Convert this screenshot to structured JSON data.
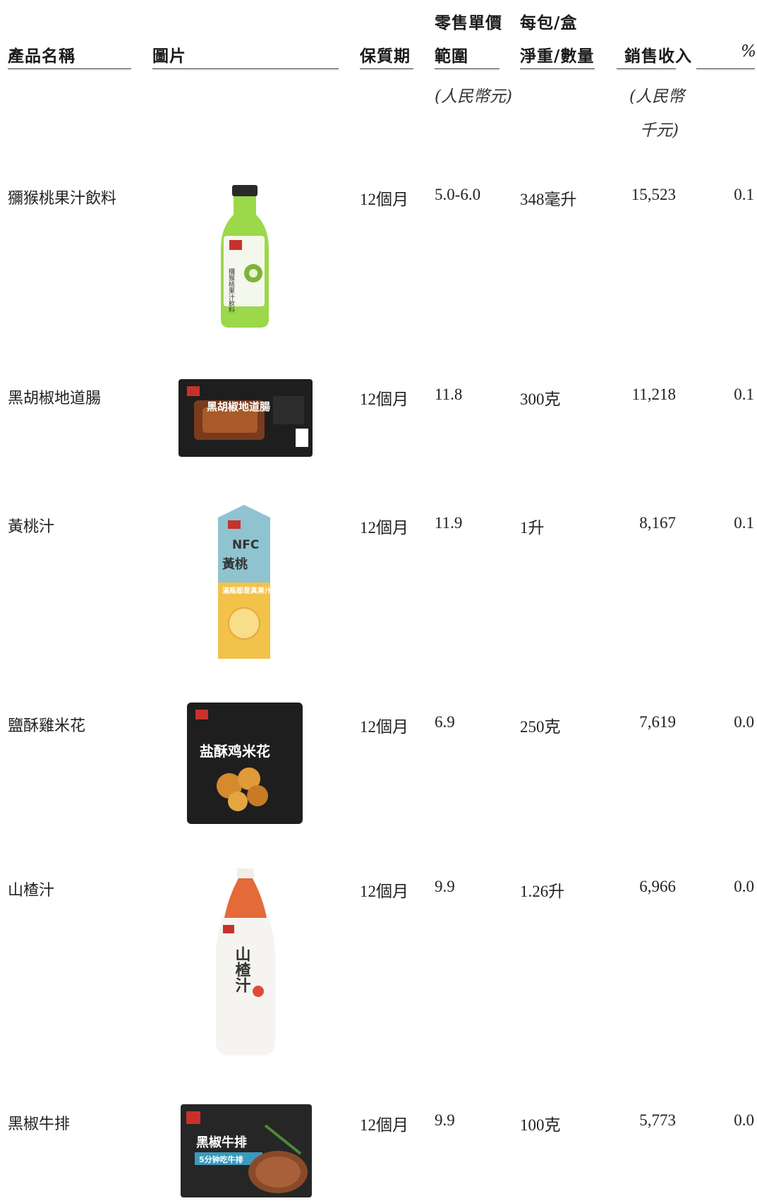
{
  "headers": {
    "product_name": "產品名稱",
    "image": "圖片",
    "shelf_life": "保質期",
    "price_line1": "零售單價",
    "price_line2": "範圍",
    "price_unit": "(人民幣元)",
    "weight_line1": "每包/盒",
    "weight_line2": "淨重/數量",
    "revenue": "銷售收入",
    "revenue_unit_line1": "(人民幣",
    "revenue_unit_line2": "千元)",
    "percent": "%"
  },
  "rows": [
    {
      "name": "獼猴桃果汁飲料",
      "image_icon": "kiwi-juice-bottle",
      "shelf_life": "12個月",
      "price": "5.0-6.0",
      "weight": "348毫升",
      "revenue": "15,523",
      "percent": "0.1"
    },
    {
      "name": "黑胡椒地道腸",
      "image_icon": "black-pepper-sausage-pack",
      "shelf_life": "12個月",
      "price": "11.8",
      "weight": "300克",
      "revenue": "11,218",
      "percent": "0.1"
    },
    {
      "name": "黃桃汁",
      "image_icon": "yellow-peach-juice-carton",
      "shelf_life": "12個月",
      "price": "11.9",
      "weight": "1升",
      "revenue": "8,167",
      "percent": "0.1"
    },
    {
      "name": "鹽酥雞米花",
      "image_icon": "popcorn-chicken-bag",
      "shelf_life": "12個月",
      "price": "6.9",
      "weight": "250克",
      "revenue": "7,619",
      "percent": "0.0"
    },
    {
      "name": "山楂汁",
      "image_icon": "hawthorn-juice-bottle",
      "shelf_life": "12個月",
      "price": "9.9",
      "weight": "1.26升",
      "revenue": "6,966",
      "percent": "0.0"
    },
    {
      "name": "黑椒牛排",
      "image_icon": "black-pepper-steak-pack",
      "shelf_life": "12個月",
      "price": "9.9",
      "weight": "100克",
      "revenue": "5,773",
      "percent": "0.0"
    }
  ],
  "package_text": {
    "kiwi_label": "獼猴桃果汁飲料",
    "sausage_label": "黑胡椒地道腸",
    "peach_nfc": "NFC",
    "peach_name": "黃桃",
    "peach_slogan": "滿瓶都是真果汁",
    "popcorn_label": "盐酥鸡米花",
    "hawthorn_label": "山楂汁",
    "steak_label": "黑椒牛排",
    "steak_sub": "5分钟吃牛排"
  },
  "colors": {
    "kiwi_green": "#9bd84a",
    "dark_pack": "#1e1e1e",
    "peach_yellow": "#f2c24a",
    "peach_blue": "#8fc3cf",
    "hawthorn_orange": "#e46a3a",
    "brand_red": "#c8312b"
  }
}
